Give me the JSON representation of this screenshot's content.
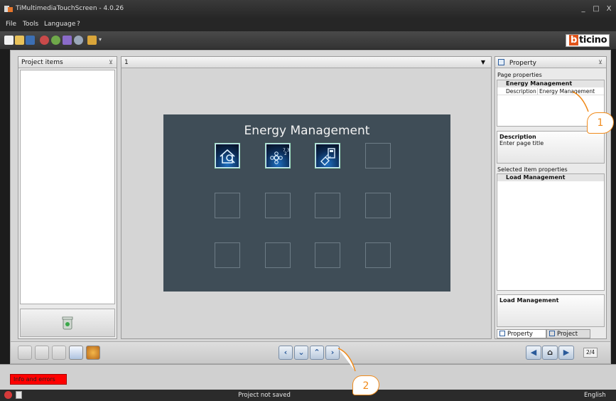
{
  "window": {
    "title": "TiMultimediaTouchScreen - 4.0.26",
    "minimize": "_",
    "maximize": "□",
    "close": "X"
  },
  "menu": [
    "File",
    "Tools",
    "Language",
    "?"
  ],
  "brand": {
    "b": "b",
    "rest": "ticino"
  },
  "project_panel": {
    "title": "Project items",
    "pin": "⊻"
  },
  "canvas": {
    "page_selector": "1",
    "dropdown_arrow": "▼"
  },
  "page": {
    "title": "Energy Management",
    "icons": [
      "home-search-icon",
      "flower-temperature-icon",
      "plug-meter-icon"
    ],
    "empty_tiles": 9
  },
  "property_panel": {
    "title": "Property",
    "pin": "⊻",
    "page_properties_label": "Page properties",
    "group_name": "Energy Management",
    "row_key": "Description",
    "row_value": "Energy Management",
    "description_title": "Description",
    "description_text": "Enter page title",
    "selected_props_label": "Selected item properties",
    "selected_group": "Load Management",
    "selected_desc_title": "Load Management",
    "tab_property": "Property",
    "tab_project": "Project"
  },
  "bottom": {
    "page_counter": "2/4"
  },
  "info_button": "Info and errors",
  "status": {
    "center": "Project not saved",
    "language": "English"
  },
  "callouts": [
    "1",
    "2"
  ],
  "colors": {
    "accent": "#f08a1a",
    "page_bg": "#3f4d57",
    "error_button": "#ff0000"
  }
}
